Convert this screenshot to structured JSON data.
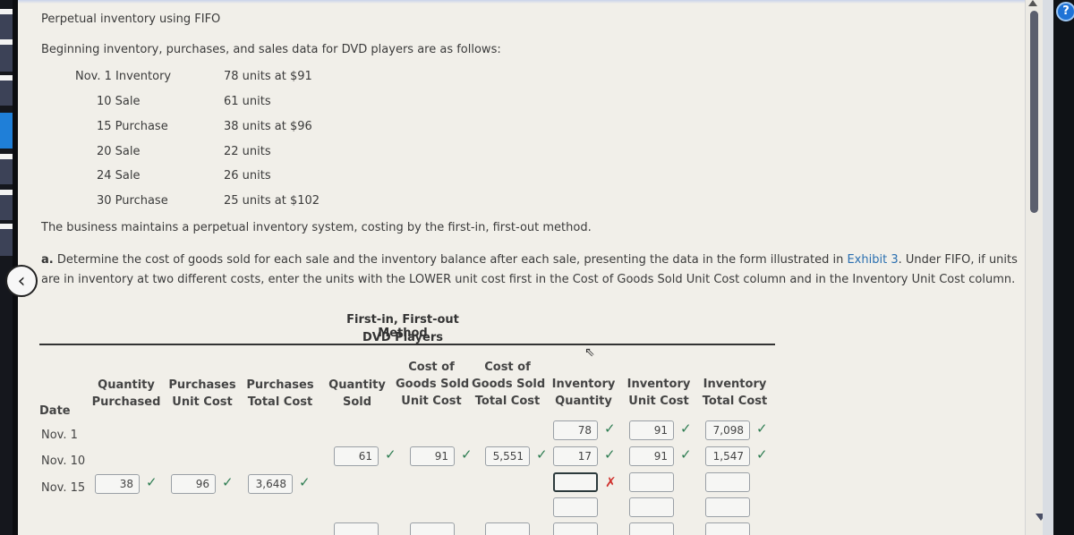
{
  "problem": {
    "title": "Perpetual inventory using FIFO",
    "intro": "Beginning inventory, purchases, and sales data for DVD players are as follows:",
    "transactions": [
      {
        "label": "Nov. 1 Inventory",
        "detail": "78 units at $91"
      },
      {
        "label": "10 Sale",
        "detail": "61 units"
      },
      {
        "label": "15 Purchase",
        "detail": "38 units at $96"
      },
      {
        "label": "20 Sale",
        "detail": "22 units"
      },
      {
        "label": "24 Sale",
        "detail": "26 units"
      },
      {
        "label": "30 Purchase",
        "detail": "25 units at $102"
      }
    ],
    "method_note": "The business maintains a perpetual inventory system, costing by the first-in, first-out method.",
    "part_a": {
      "label": "a.",
      "text_before_link": " Determine the cost of goods sold for each sale and the inventory balance after each sale, presenting the data in the form illustrated in ",
      "link": "Exhibit 3",
      "text_after_link": ". Under FIFO, if units are in inventory at two different costs, enter the units with the LOWER unit cost first in the Cost of Goods Sold Unit Cost column and in the Inventory Unit Cost column."
    }
  },
  "table": {
    "title_line1": "First-in, First-out Method",
    "title_line2": "DVD Players",
    "headers": {
      "date": "Date",
      "qty_purchased": [
        "Quantity",
        "Purchased"
      ],
      "purch_unit_cost": [
        "Purchases",
        "Unit Cost"
      ],
      "purch_total_cost": [
        "Purchases",
        "Total Cost"
      ],
      "qty_sold": [
        "Quantity",
        "Sold"
      ],
      "cogs_unit_cost": [
        "Cost of",
        "Goods Sold",
        "Unit Cost"
      ],
      "cogs_total_cost": [
        "Cost of",
        "Goods Sold",
        "Total Cost"
      ],
      "inv_qty": [
        "Inventory",
        "Quantity"
      ],
      "inv_unit_cost": [
        "Inventory",
        "Unit Cost"
      ],
      "inv_total_cost": [
        "Inventory",
        "Total Cost"
      ]
    },
    "rows": [
      {
        "date": "Nov. 1",
        "inv_qty": "78",
        "inv_unit_cost": "91",
        "inv_total_cost": "7,098"
      },
      {
        "date": "Nov. 10",
        "qty_sold": "61",
        "cogs_unit_cost": "91",
        "cogs_total_cost": "5,551",
        "inv_qty": "17",
        "inv_unit_cost": "91",
        "inv_total_cost": "1,547"
      },
      {
        "date": "Nov. 15",
        "qty_purchased": "38",
        "purch_unit_cost": "96",
        "purch_total_cost": "3,648",
        "inv_qty": "",
        "inv_unit_cost": "",
        "inv_total_cost": ""
      }
    ],
    "status": {
      "correct": "✓",
      "incorrect": "✗"
    }
  },
  "icons": {
    "back": "‹",
    "help": "?",
    "cursor": "⇖"
  }
}
